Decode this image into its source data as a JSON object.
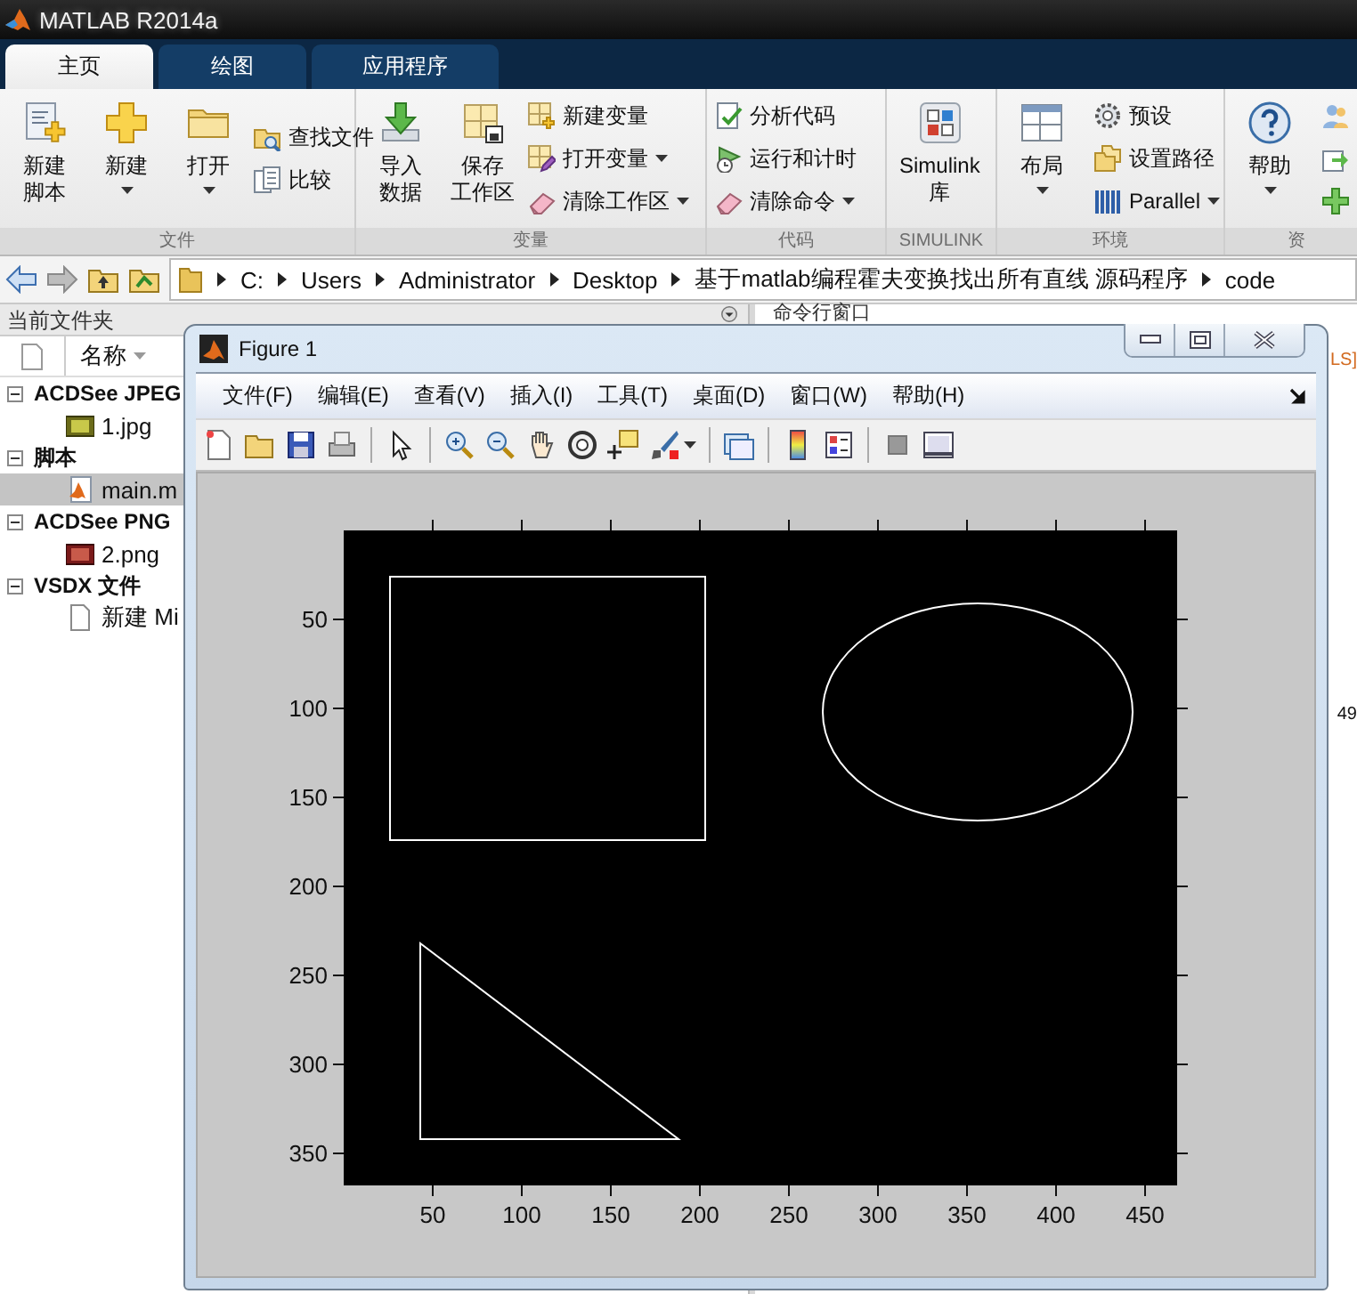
{
  "app": {
    "title": "MATLAB R2014a"
  },
  "tabs": [
    {
      "label": "主页",
      "selected": true
    },
    {
      "label": "绘图",
      "selected": false
    },
    {
      "label": "应用程序",
      "selected": false
    }
  ],
  "ribbon": {
    "groups": [
      {
        "label": "文件",
        "items": [
          {
            "kind": "large",
            "label": [
              "新建",
              "脚本"
            ],
            "dropdown": false
          },
          {
            "kind": "large",
            "label": [
              "新建"
            ],
            "dropdown": true
          },
          {
            "kind": "large",
            "label": [
              "打开"
            ],
            "dropdown": true
          },
          {
            "kind": "stack",
            "items": [
              {
                "kind": "small",
                "label": "查找文件",
                "dropdown": false
              },
              {
                "kind": "small",
                "label": "比较",
                "dropdown": false
              }
            ]
          }
        ]
      },
      {
        "label": "变量",
        "items": [
          {
            "kind": "large",
            "label": [
              "导入",
              "数据"
            ],
            "dropdown": false
          },
          {
            "kind": "large",
            "label": [
              "保存",
              "工作区"
            ],
            "dropdown": false
          },
          {
            "kind": "stack",
            "items": [
              {
                "kind": "small",
                "label": "新建变量",
                "dropdown": false
              },
              {
                "kind": "small",
                "label": "打开变量",
                "dropdown": true
              },
              {
                "kind": "small",
                "label": "清除工作区",
                "dropdown": true
              }
            ]
          }
        ]
      },
      {
        "label": "代码",
        "items": [
          {
            "kind": "stack",
            "items": [
              {
                "kind": "small",
                "label": "分析代码",
                "dropdown": false
              },
              {
                "kind": "small",
                "label": "运行和计时",
                "dropdown": false
              },
              {
                "kind": "small",
                "label": "清除命令",
                "dropdown": true
              }
            ]
          }
        ]
      },
      {
        "label": "SIMULINK",
        "items": [
          {
            "kind": "large",
            "label": [
              "Simulink",
              "库"
            ],
            "dropdown": false
          }
        ]
      },
      {
        "label": "环境",
        "items": [
          {
            "kind": "large",
            "label": [
              "布局"
            ],
            "dropdown": true
          },
          {
            "kind": "stack",
            "items": [
              {
                "kind": "small",
                "label": "预设",
                "dropdown": false
              },
              {
                "kind": "small",
                "label": "设置路径",
                "dropdown": false
              },
              {
                "kind": "small",
                "label": "Parallel",
                "dropdown": true
              }
            ]
          }
        ]
      },
      {
        "label": "资",
        "items": [
          {
            "kind": "large",
            "label": [
              "帮助"
            ],
            "dropdown": true
          },
          {
            "kind": "stack",
            "items": [
              {
                "kind": "icon"
              },
              {
                "kind": "icon"
              },
              {
                "kind": "icon"
              }
            ]
          }
        ]
      }
    ]
  },
  "address": {
    "segments": [
      "C:",
      "Users",
      "Administrator",
      "Desktop",
      "基于matlab编程霍夫变换找出所有直线 源码程序",
      "code"
    ]
  },
  "current_folder": {
    "title": "当前文件夹",
    "column": "名称",
    "groups": [
      {
        "label": "ACDSee JPEG",
        "expanded": true,
        "children": [
          {
            "name": "1.jpg",
            "kind": "jpg",
            "selected": false
          }
        ]
      },
      {
        "label": "脚本",
        "expanded": true,
        "children": [
          {
            "name": "main.m",
            "kind": "m",
            "selected": true
          }
        ]
      },
      {
        "label": "ACDSee PNG",
        "expanded": true,
        "children": [
          {
            "name": "2.png",
            "kind": "png",
            "selected": false
          }
        ]
      },
      {
        "label": "VSDX 文件",
        "expanded": true,
        "children": [
          {
            "name": "新建 Mi",
            "kind": "doc",
            "selected": false
          }
        ]
      }
    ]
  },
  "command_window": {
    "title": "命令行窗口",
    "fragments": [
      {
        "text": "LS]",
        "kind": "link"
      },
      {
        "text": "49",
        "kind": "plain"
      }
    ]
  },
  "figure": {
    "title": "Figure 1",
    "menus": [
      "文件(F)",
      "编辑(E)",
      "查看(V)",
      "插入(I)",
      "工具(T)",
      "桌面(D)",
      "窗口(W)",
      "帮助(H)"
    ],
    "axes": {
      "yticks": [
        "50",
        "100",
        "150",
        "200",
        "250",
        "300",
        "350"
      ],
      "xticks": [
        "50",
        "100",
        "150",
        "200",
        "250",
        "300",
        "350",
        "400",
        "450"
      ]
    }
  }
}
